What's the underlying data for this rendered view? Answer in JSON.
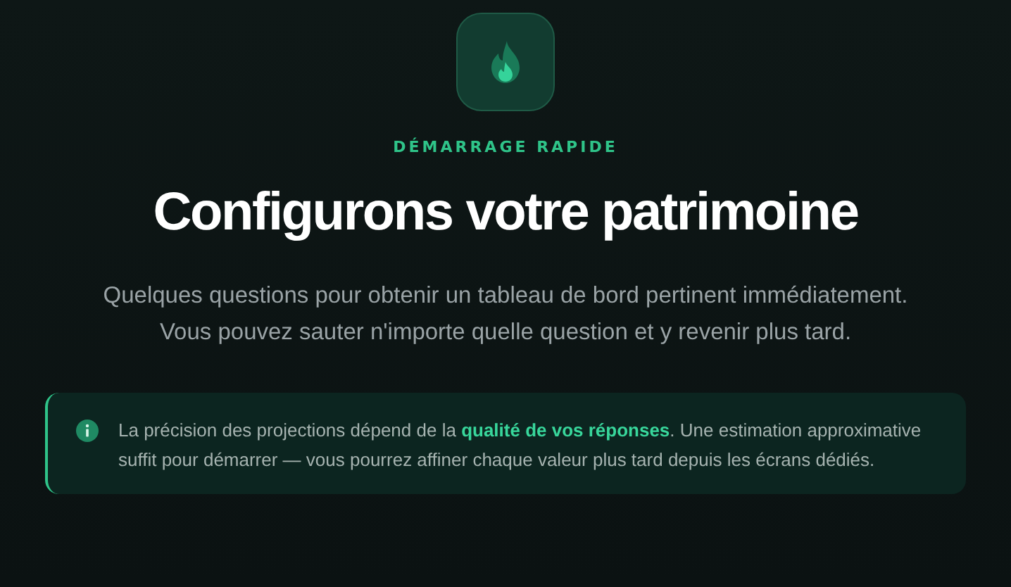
{
  "eyebrow": "DÉMARRAGE RAPIDE",
  "title": "Configurons votre patrimoine",
  "intro": "Quelques questions pour obtenir un tableau de bord pertinent immédiatement. Vous pouvez sauter n'importe quelle question et y revenir plus tard.",
  "notice": {
    "text": "La précision des projections dépend de la **qualité de vos réponses**. Une estimation approximative suffit pour démarrer — vous pourrez affiner chaque valeur plus tard depuis les écrans dédiés."
  }
}
